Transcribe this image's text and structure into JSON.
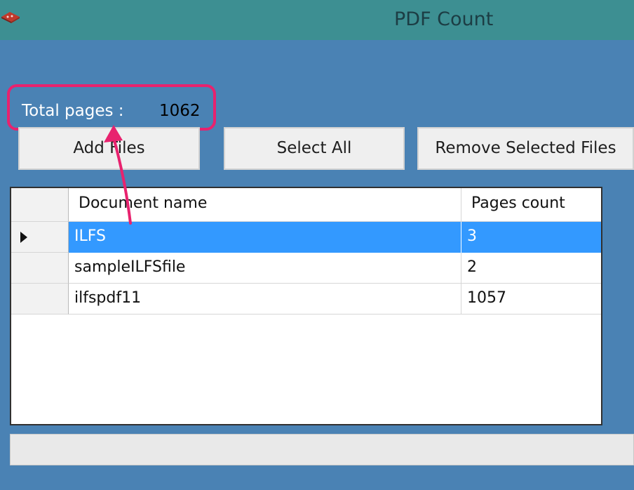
{
  "window": {
    "title": "PDF Count",
    "icon": "app-icon"
  },
  "summary": {
    "label": "Total pages :",
    "value": "1062"
  },
  "buttons": {
    "add_files": "Add Files",
    "select_all": "Select All",
    "remove_selected": "Remove Selected Files"
  },
  "grid": {
    "columns": [
      "Document name",
      "Pages count"
    ],
    "rows": [
      {
        "name": "ILFS",
        "pages": "3",
        "selected": true,
        "current": true
      },
      {
        "name": "sampleILFSfile",
        "pages": "2",
        "selected": false,
        "current": false
      },
      {
        "name": "ilfspdf11",
        "pages": "1057",
        "selected": false,
        "current": false
      }
    ],
    "row_indicator_icon": "triangle-right-icon"
  },
  "colors": {
    "background": "#4a82b4",
    "titlebar": "#3d8f92",
    "highlight": "#e8226e",
    "selection": "#3399ff"
  }
}
